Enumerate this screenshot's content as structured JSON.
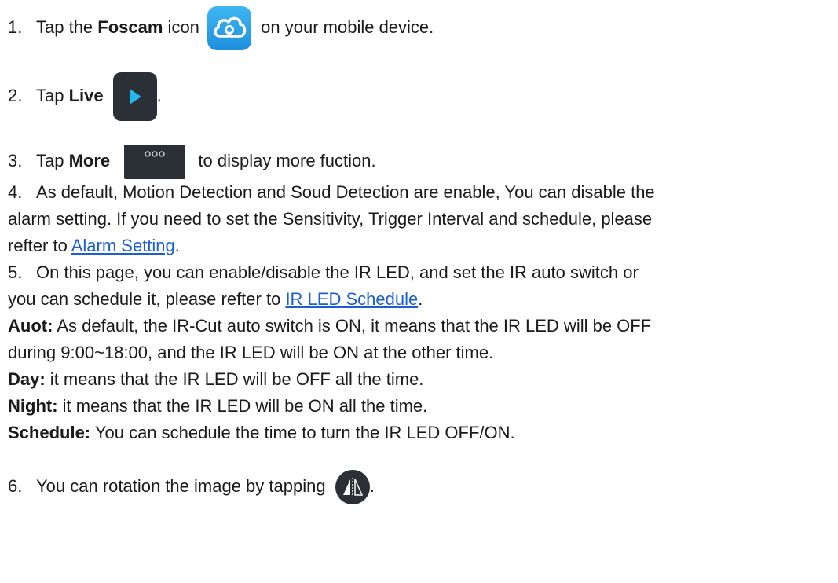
{
  "steps": [
    {
      "num": "1.",
      "pre": "Tap the ",
      "bold": "Foscam",
      "post": " icon",
      "after_icon": " on your mobile device."
    },
    {
      "num": "2.",
      "pre": "Tap ",
      "bold": "Live",
      "after_icon": "."
    },
    {
      "num": "3.",
      "pre": "Tap ",
      "bold": "More",
      "after_icon": " to display more fuction."
    },
    {
      "num": "4.",
      "text_line1": "As default, Motion Detection and Soud Detection are enable, You can disable the",
      "text_line2": "alarm setting. If you need to set the Sensitivity, Trigger Interval and schedule, please",
      "text_line3_pre": "refter to ",
      "link": "Alarm Setting",
      "text_line3_post": "."
    },
    {
      "num": "5.",
      "text_line1": "On this page, you can enable/disable the IR LED, and set the IR auto switch or",
      "text_line2_pre": "you can schedule it, please refter to ",
      "link": "IR LED Schedule",
      "text_line2_post": "."
    },
    {
      "num": "6.",
      "text": "You can rotation the image by tapping",
      "after_icon": "."
    }
  ],
  "modes": [
    {
      "label": "Auot:",
      "line1": " As default, the IR-Cut auto switch is ON, it means that the IR LED will be OFF",
      "line2": "during 9:00~18:00, and the IR LED will be ON at the other time."
    },
    {
      "label": "Day:",
      "line1": " it means that the IR LED will be OFF all the time."
    },
    {
      "label": "Night:",
      "line1": " it means that the IR LED will be ON all the time."
    },
    {
      "label": "Schedule:",
      "line1": " You can schedule the time to turn the IR LED OFF/ON."
    }
  ],
  "icons": {
    "foscam": "foscam-cloud-icon",
    "live": "play-icon",
    "more": "more-dots-icon",
    "rotate": "mirror-flip-icon"
  },
  "colors": {
    "link": "#1b5fd1",
    "foscam_icon": "#2aa3ea",
    "live_icon_bg": "#2b2f36",
    "play_arrow": "#21b8ef"
  }
}
